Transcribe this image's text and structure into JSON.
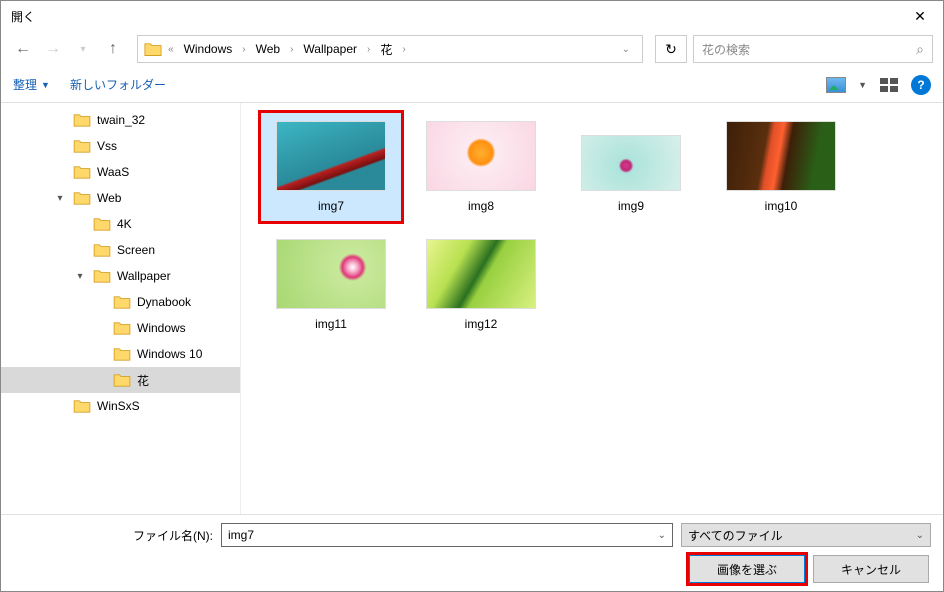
{
  "title": "開く",
  "breadcrumb": {
    "lead": "«",
    "items": [
      "Windows",
      "Web",
      "Wallpaper",
      "花"
    ]
  },
  "search": {
    "placeholder": "花の検索"
  },
  "toolbar": {
    "organize": "整理",
    "newfolder": "新しいフォルダー"
  },
  "tree": [
    {
      "label": "twain_32",
      "depth": 2,
      "exp": ""
    },
    {
      "label": "Vss",
      "depth": 2,
      "exp": ""
    },
    {
      "label": "WaaS",
      "depth": 2,
      "exp": ""
    },
    {
      "label": "Web",
      "depth": 2,
      "exp": "▾"
    },
    {
      "label": "4K",
      "depth": 3,
      "exp": ""
    },
    {
      "label": "Screen",
      "depth": 3,
      "exp": ""
    },
    {
      "label": "Wallpaper",
      "depth": 3,
      "exp": "▾"
    },
    {
      "label": "Dynabook",
      "depth": 4,
      "exp": ""
    },
    {
      "label": "Windows",
      "depth": 4,
      "exp": ""
    },
    {
      "label": "Windows 10",
      "depth": 4,
      "exp": ""
    },
    {
      "label": "花",
      "depth": 4,
      "exp": "",
      "selected": true
    },
    {
      "label": "WinSxS",
      "depth": 2,
      "exp": ""
    }
  ],
  "thumbs": [
    {
      "label": "img7",
      "ph": "ph1",
      "selected": true
    },
    {
      "label": "img8",
      "ph": "ph2"
    },
    {
      "label": "img9",
      "ph": "ph3",
      "sm": true
    },
    {
      "label": "img10",
      "ph": "ph4"
    },
    {
      "label": "img11",
      "ph": "ph5"
    },
    {
      "label": "img12",
      "ph": "ph6"
    }
  ],
  "footer": {
    "fname_label": "ファイル名(N):",
    "fname_value": "img7",
    "filter": "すべてのファイル",
    "select_btn": "画像を選ぶ",
    "cancel_btn": "キャンセル"
  }
}
